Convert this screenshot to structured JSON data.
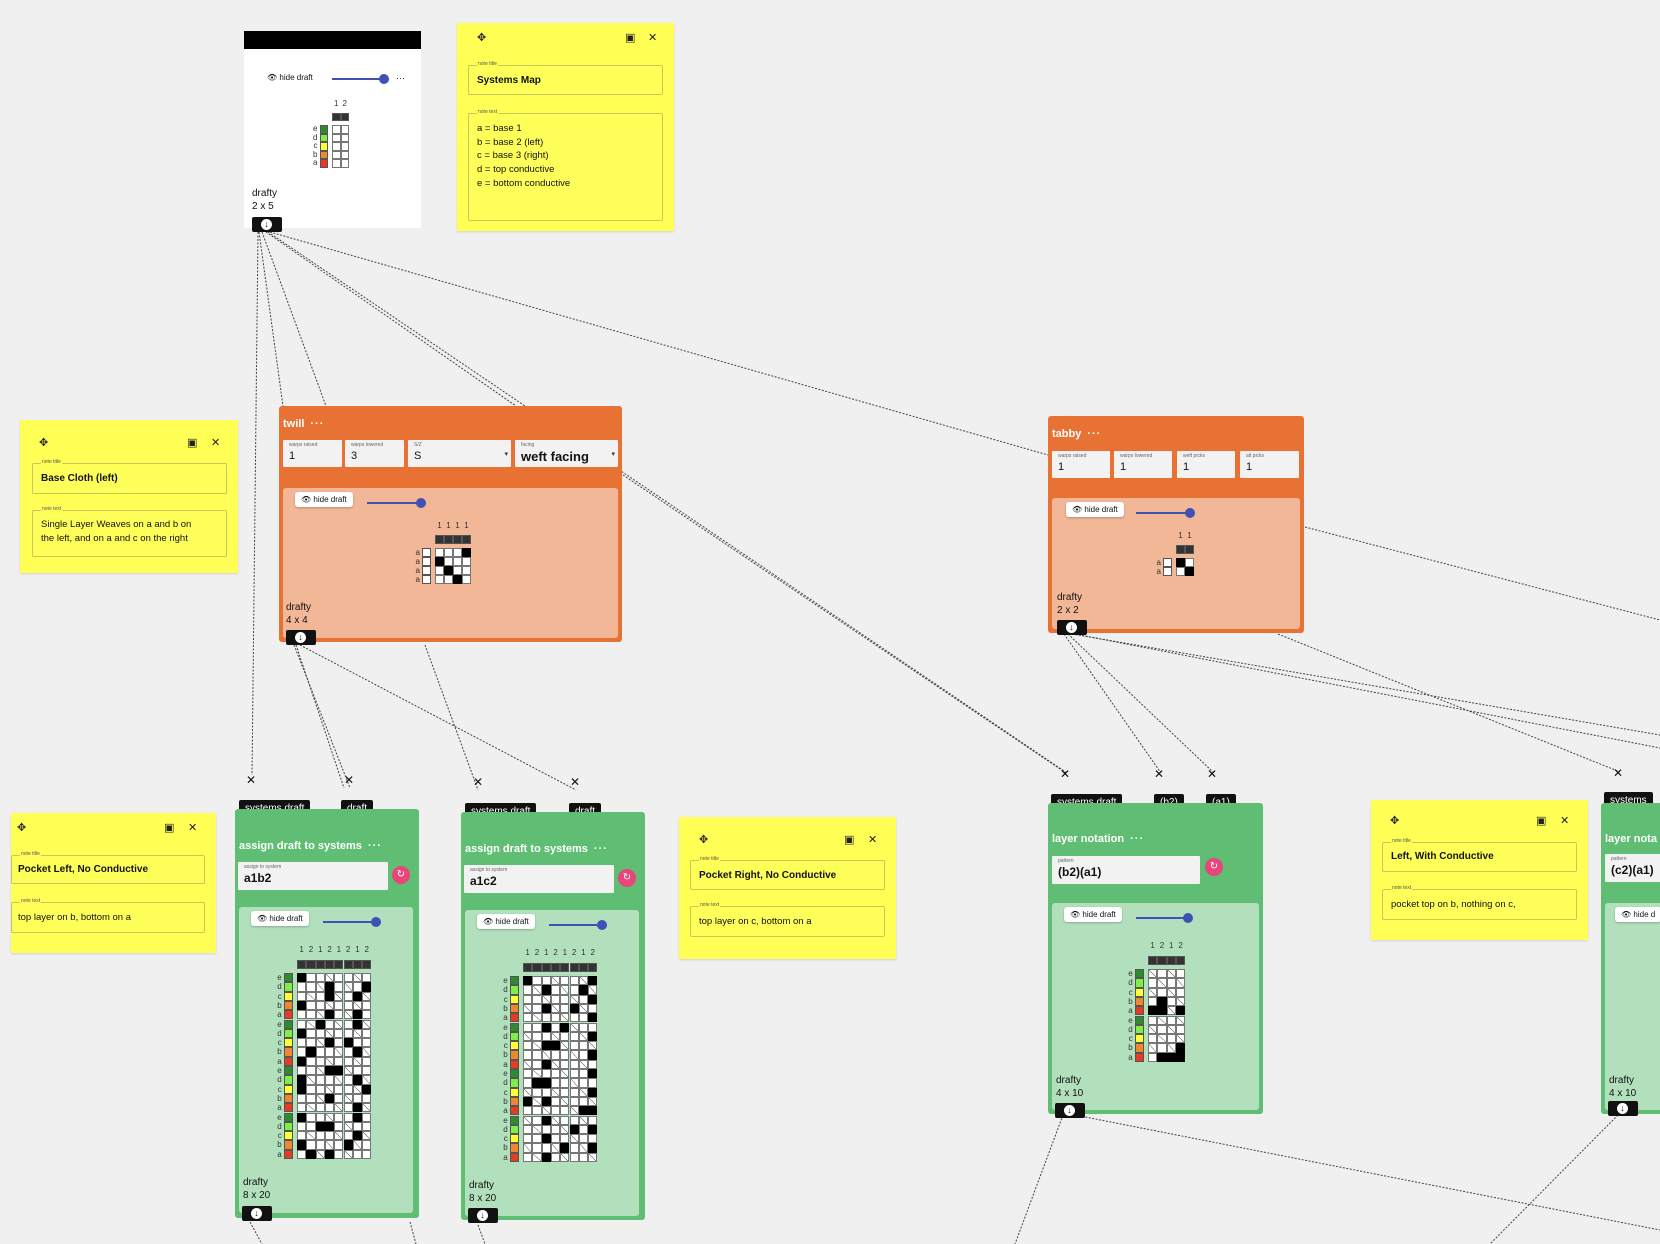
{
  "theme": {
    "operation_orange": "#e87234",
    "operation_green": "#5fbd74",
    "note_yellow": "#ffff55",
    "slider_blue": "#3f51b5",
    "refresh_pink": "#e8457a",
    "system_colors": {
      "a": "#e53a24",
      "b": "#f08630",
      "c": "#ffff33",
      "d": "#7cf046",
      "e": "#2e8b2e"
    }
  },
  "icons": {
    "move": "move-icon",
    "image": "image-icon",
    "close": "close-icon",
    "eye": "eye-icon",
    "download": "download-icon",
    "refresh": "refresh-icon",
    "input_x": "close-x-icon"
  },
  "notes": {
    "systems_map": {
      "title_label": "note title",
      "title": "Systems Map",
      "text_label": "note text",
      "lines": [
        "a = base 1",
        "b = base 2 (left)",
        "c = base 3 (right)",
        "d = top conductive",
        "e = bottom conductive"
      ]
    },
    "base_cloth": {
      "title_label": "note title",
      "title": "Base Cloth (left)",
      "text_label": "note text",
      "lines": [
        "Single Layer Weaves on a and b on",
        "the left, and on a and c on the right"
      ]
    },
    "pocket_left": {
      "title_label": "note title",
      "title": "Pocket Left, No Conductive",
      "text_label": "note text",
      "text": "top layer on b, bottom on a"
    },
    "pocket_right": {
      "title_label": "note title",
      "title": "Pocket Right, No Conductive",
      "text_label": "note text",
      "text": "top layer on c, bottom on a"
    },
    "left_conductive": {
      "title_label": "note title",
      "title": "Left, With Conductive",
      "text_label": "note text",
      "text": "pocket top on b, nothing on c,"
    }
  },
  "top_draft": {
    "hide_label": "hide draft",
    "more": "···",
    "name": "drafty",
    "size": "2 x 5",
    "warp_labels": [
      "1",
      "2"
    ],
    "weft_labels": [
      "e",
      "d",
      "c",
      "b",
      "a"
    ]
  },
  "twill": {
    "title": "twill",
    "more": "···",
    "params": [
      {
        "label": "warps raised",
        "value": "1"
      },
      {
        "label": "warps lowered",
        "value": "3"
      },
      {
        "label": "S/Z",
        "value": "S"
      },
      {
        "label": "facing",
        "value": "weft facing"
      }
    ],
    "hide_label": "hide draft",
    "name": "drafty",
    "size": "4 x 4",
    "warp_labels": [
      "1",
      "1",
      "1",
      "1"
    ],
    "weft_labels": [
      "a",
      "a",
      "a",
      "a"
    ]
  },
  "tabby": {
    "title": "tabby",
    "more": "···",
    "params": [
      {
        "label": "warps raised",
        "value": "1"
      },
      {
        "label": "warps lowered",
        "value": "1"
      },
      {
        "label": "weft picks",
        "value": "1"
      },
      {
        "label": "alt picks",
        "value": "1"
      }
    ],
    "hide_label": "hide draft",
    "name": "drafty",
    "size": "2 x 2",
    "warp_labels": [
      "1",
      "1"
    ],
    "weft_labels": [
      "a",
      "a"
    ]
  },
  "assign1": {
    "inputs": [
      "systems draft",
      "draft"
    ],
    "title": "assign draft to systems",
    "more": "···",
    "field_label": "assign to system",
    "field_value": "a1b2",
    "hide_label": "hide draft",
    "name": "drafty",
    "size": "8 x 20",
    "warp_labels": [
      "1",
      "2",
      "1",
      "2",
      "1",
      "2",
      "1",
      "2"
    ],
    "weft_labels": [
      "e",
      "d",
      "c",
      "b",
      "a",
      "e",
      "d",
      "c",
      "b",
      "a",
      "e",
      "d",
      "c",
      "b",
      "a",
      "e",
      "d",
      "c",
      "b",
      "a"
    ]
  },
  "assign2": {
    "inputs": [
      "systems draft",
      "draft"
    ],
    "title": "assign draft to systems",
    "more": "···",
    "field_label": "assign to system",
    "field_value": "a1c2",
    "hide_label": "hide draft",
    "name": "drafty",
    "size": "8 x 20",
    "warp_labels": [
      "1",
      "2",
      "1",
      "2",
      "1",
      "2",
      "1",
      "2"
    ],
    "weft_labels": [
      "e",
      "d",
      "c",
      "b",
      "a",
      "e",
      "d",
      "c",
      "b",
      "a",
      "e",
      "d",
      "c",
      "b",
      "a",
      "e",
      "d",
      "c",
      "b",
      "a"
    ]
  },
  "layer1": {
    "inputs": [
      "systems draft",
      "(b2)",
      "(a1)"
    ],
    "title": "layer notation",
    "more": "···",
    "field_label": "pattern",
    "field_value": "(b2)(a1)",
    "hide_label": "hide draft",
    "name": "drafty",
    "size": "4 x 10",
    "warp_labels": [
      "1",
      "2",
      "1",
      "2"
    ],
    "weft_labels": [
      "e",
      "d",
      "c",
      "b",
      "a",
      "e",
      "d",
      "c",
      "b",
      "a"
    ]
  },
  "layer2": {
    "inputs": [
      "systems"
    ],
    "title": "layer nota",
    "field_label": "pattern",
    "field_value": "(c2)(a1)",
    "hide_label": "hide d",
    "name": "drafty",
    "size": "4 x 10"
  }
}
